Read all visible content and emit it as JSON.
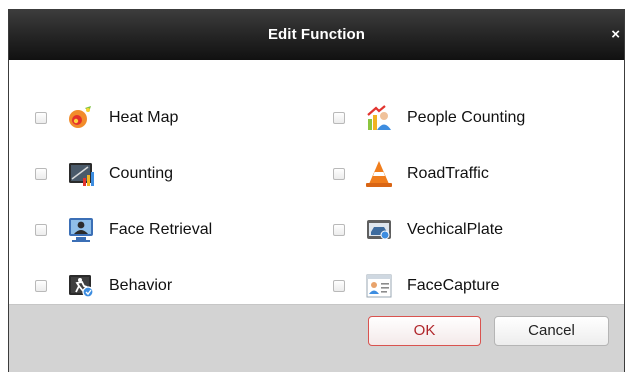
{
  "dialog": {
    "title": "Edit Function",
    "close_symbol": "×"
  },
  "functions_left": [
    {
      "label": "Heat Map",
      "icon": "heat-map-icon",
      "checked": false
    },
    {
      "label": "Counting",
      "icon": "counting-icon",
      "checked": false
    },
    {
      "label": "Face Retrieval",
      "icon": "face-retrieval-icon",
      "checked": false
    },
    {
      "label": "Behavior",
      "icon": "behavior-icon",
      "checked": false
    }
  ],
  "functions_right": [
    {
      "label": "People Counting",
      "icon": "people-counting-icon",
      "checked": false
    },
    {
      "label": "RoadTraffic",
      "icon": "road-traffic-icon",
      "checked": false
    },
    {
      "label": "VechicalPlate",
      "icon": "vehicle-plate-icon",
      "checked": false
    },
    {
      "label": "FaceCapture",
      "icon": "face-capture-icon",
      "checked": false
    }
  ],
  "buttons": {
    "ok": "OK",
    "cancel": "Cancel"
  },
  "colors": {
    "titlebar": "#262626",
    "footer": "#d3d3d3",
    "ok_border": "#d9534f"
  }
}
